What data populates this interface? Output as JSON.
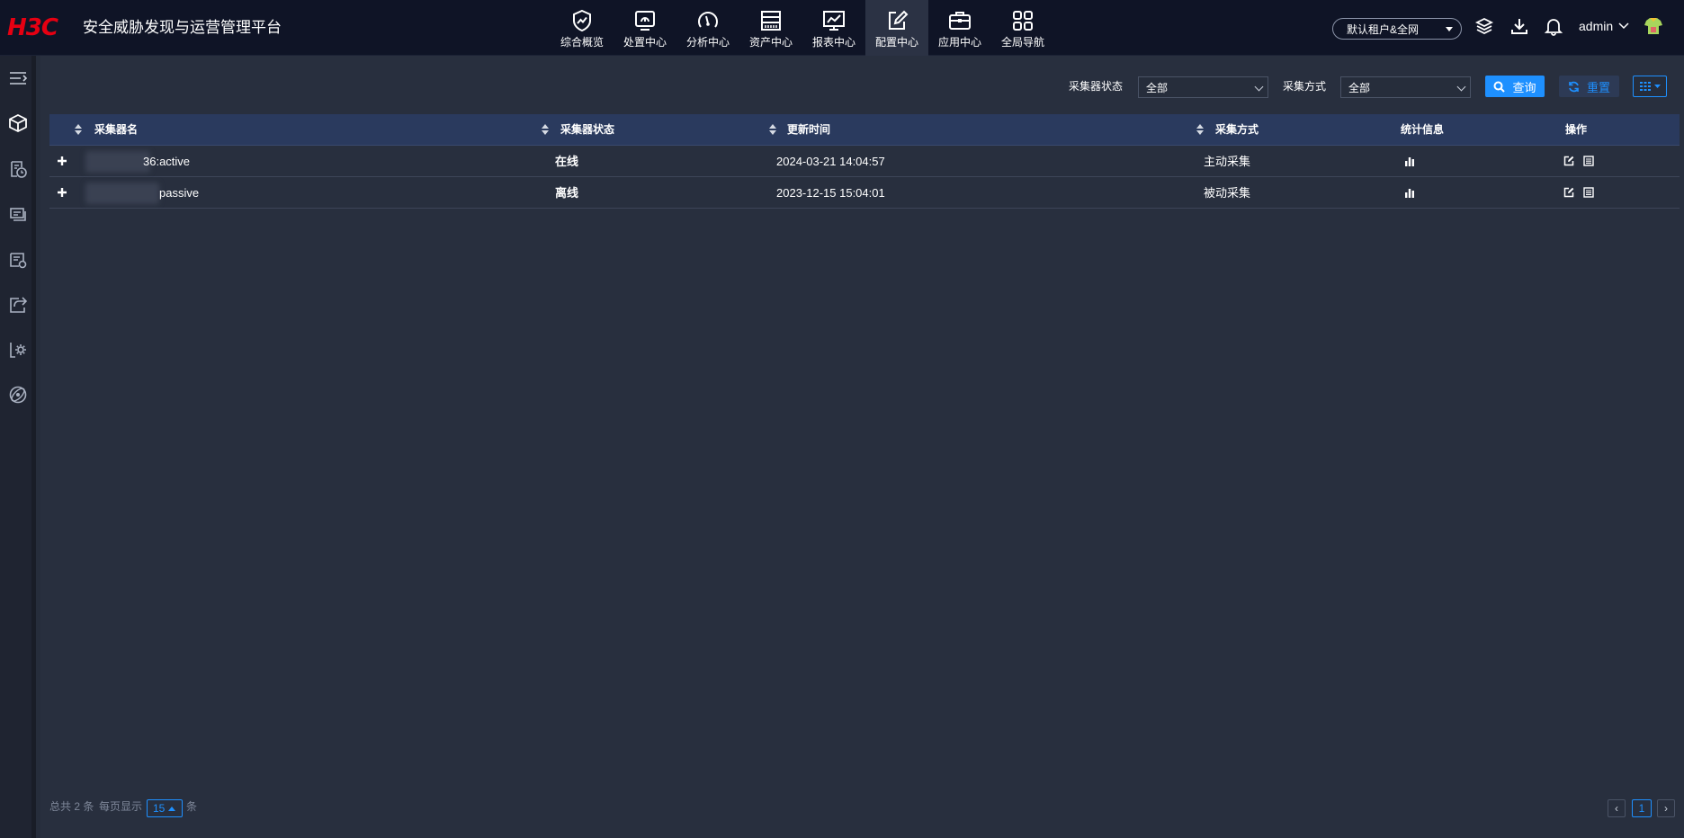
{
  "app": {
    "logo_text": "H3C",
    "title": "安全威胁发现与运营管理平台"
  },
  "nav": [
    {
      "label": "综合概览",
      "icon": "shield-chart-icon"
    },
    {
      "label": "处置中心",
      "icon": "monitor-gauge-icon"
    },
    {
      "label": "分析中心",
      "icon": "speedometer-icon"
    },
    {
      "label": "资产中心",
      "icon": "server-rack-icon"
    },
    {
      "label": "报表中心",
      "icon": "line-chart-icon"
    },
    {
      "label": "配置中心",
      "icon": "edit-icon"
    },
    {
      "label": "应用中心",
      "icon": "briefcase-icon"
    },
    {
      "label": "全局导航",
      "icon": "grid-icon"
    }
  ],
  "header_right": {
    "tenant_label": "默认租户&全网",
    "user_label": "admin"
  },
  "sidebar": [
    {
      "icon": "menu-collapse-icon"
    },
    {
      "icon": "cube-icon"
    },
    {
      "icon": "document-clock-icon"
    },
    {
      "icon": "cards-icon"
    },
    {
      "icon": "report-icon"
    },
    {
      "icon": "share-icon"
    },
    {
      "icon": "settings-gear-icon"
    },
    {
      "icon": "orbit-icon"
    }
  ],
  "filters": {
    "status_label": "采集器状态",
    "status_value": "全部",
    "method_label": "采集方式",
    "method_value": "全部",
    "query_label": "查询",
    "reset_label": "重置"
  },
  "table": {
    "headers": [
      "采集器名",
      "采集器状态",
      "更新时间",
      "采集方式",
      "统计信息",
      "操作"
    ],
    "rows": [
      {
        "name": "36:active",
        "status": "在线",
        "updated": "2024-03-21 14:04:57",
        "method": "主动采集"
      },
      {
        "name": "passive",
        "status": "离线",
        "updated": "2023-12-15 15:04:01",
        "method": "被动采集"
      }
    ]
  },
  "footer": {
    "total_text": "总共 2 条",
    "per_page_text": "每页显示",
    "page_size": "15",
    "unit_text": "条",
    "prev": "‹",
    "current_page": "1",
    "next": "›"
  },
  "colors": {
    "brand_red": "#e60012",
    "accent_blue": "#1e90ff",
    "topbar_bg": "#0f1426",
    "table_header_bg": "#2a3a5e"
  }
}
